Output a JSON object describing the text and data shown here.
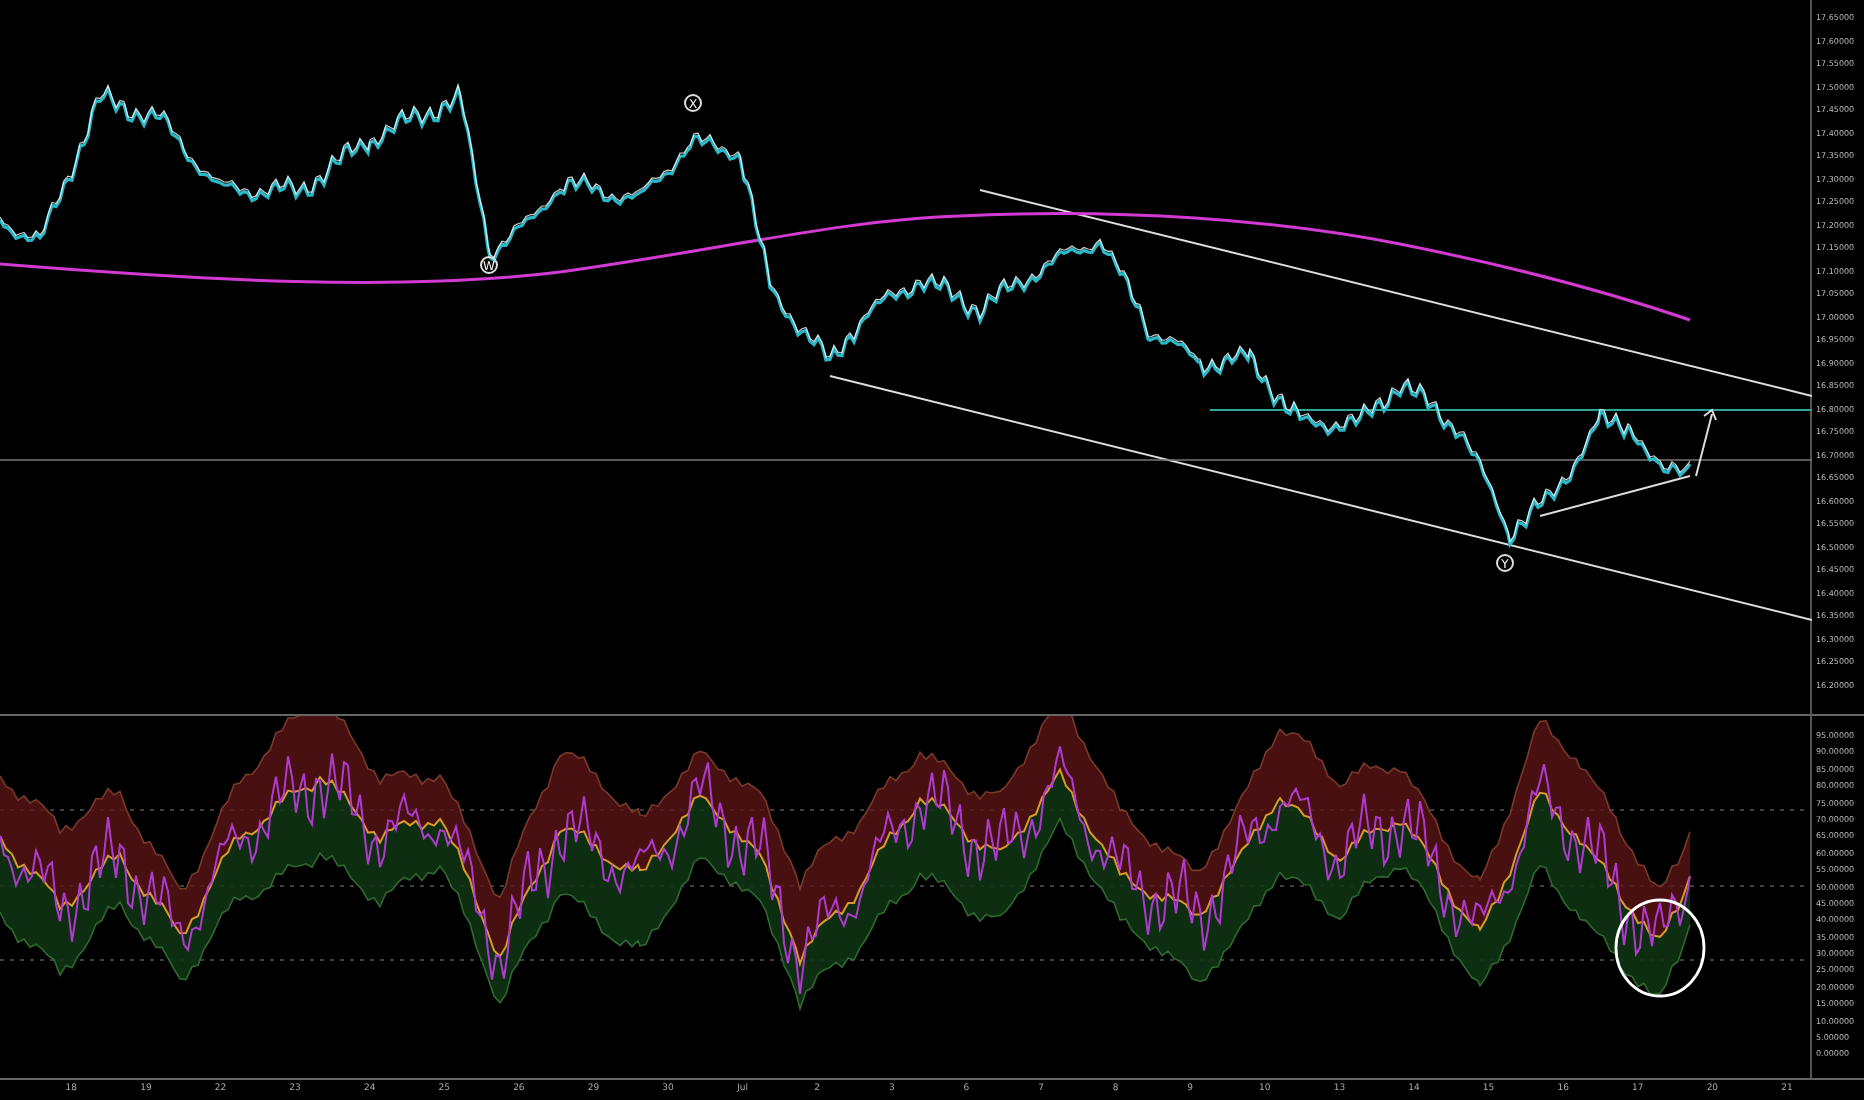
{
  "price_axis": {
    "labels": [
      "17.65000",
      "17.60000",
      "17.55000",
      "17.50000",
      "17.45000",
      "17.40000",
      "17.35000",
      "17.30000",
      "17.25000",
      "17.20000",
      "17.15000",
      "17.10000",
      "17.05000",
      "17.00000",
      "16.95000",
      "16.90000",
      "16.85000",
      "16.80000",
      "16.75000",
      "16.70000",
      "16.65000",
      "16.60000",
      "16.55000",
      "16.50000",
      "16.45000",
      "16.40000",
      "16.35000",
      "16.30000",
      "16.25000",
      "16.20000"
    ]
  },
  "wave_labels": [
    {
      "text": "W"
    },
    {
      "text": "X"
    },
    {
      "text": "Y"
    }
  ],
  "oscillator_axis": {
    "labels": [
      "95.00000",
      "90.00000",
      "85.00000",
      "80.00000",
      "75.00000",
      "70.00000",
      "65.00000",
      "60.00000",
      "55.00000",
      "50.00000",
      "45.00000",
      "40.00000",
      "35.00000",
      "30.00000",
      "25.00000",
      "20.00000",
      "15.00000",
      "10.00000",
      "5.00000",
      "0.00000"
    ]
  },
  "time_axis": {
    "labels": [
      "18",
      "19",
      "22",
      "23",
      "24",
      "25",
      "26",
      "29",
      "30",
      "Jul",
      "2",
      "3",
      "6",
      "7",
      "8",
      "9",
      "10",
      "13",
      "14",
      "15",
      "16",
      "17",
      "20",
      "21"
    ]
  }
}
